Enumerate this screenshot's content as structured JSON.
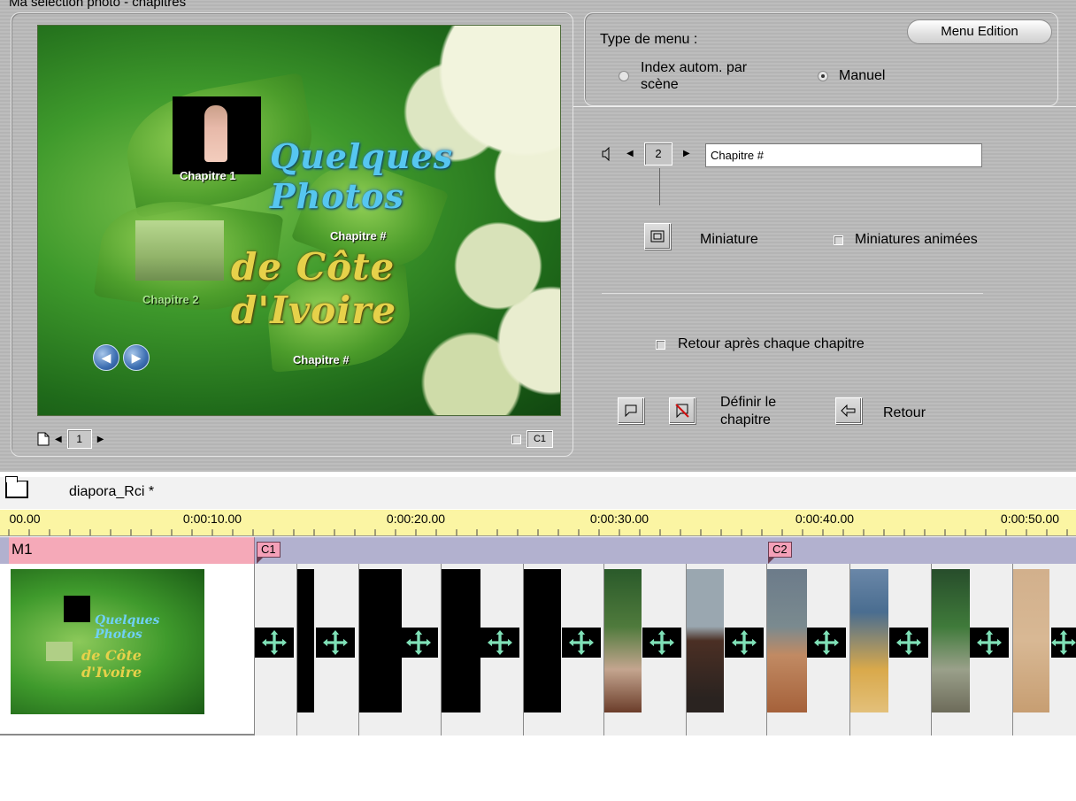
{
  "top_cut_text": "Ma sélection photo - chapitres",
  "preview": {
    "title_line1": "Quelques Photos",
    "title_line2": "de Côte d'Ivoire",
    "chapters": [
      "Chapitre 1",
      "Chapitre #",
      "Chapitre 2",
      "Chapitre #"
    ],
    "page_number": "1",
    "chapter_tag": "C1"
  },
  "menu_type": {
    "label": "Type de menu :",
    "edit_button": "Menu Edition",
    "option_auto": "Index autom. par scène",
    "option_manual": "Manuel",
    "selected": "Manuel"
  },
  "chapter_props": {
    "number": "2",
    "name_value": "Chapitre #",
    "thumbnail_label": "Miniature",
    "animated_label": "Miniatures animées",
    "return_after_label": "Retour après chaque chapitre",
    "define_label": "Définir le chapitre",
    "return_label": "Retour"
  },
  "timeline": {
    "project_name": "diapora_Rci *",
    "ruler_ticks": [
      "00.00",
      "0:00:10.00",
      "0:00:20.00",
      "0:00:30.00",
      "0:00:40.00",
      "0:00:50.00"
    ],
    "menu_label": "M1",
    "chapter_markers": [
      "C1",
      "C2"
    ],
    "thumb_line1": "Quelques Photos",
    "thumb_line2": "de Côte d'Ivoire"
  },
  "icons": {
    "sound": "speaker-icon",
    "thumbnail": "film-frame-icon",
    "page": "page-icon",
    "folder": "folder-icon",
    "transition": "move-arrows-icon"
  },
  "colors": {
    "ruler": "#fbf5a3",
    "marker_track": "#b2b1cf",
    "menu_bar": "#f5a9b8",
    "transition": "#7fe0b7"
  }
}
